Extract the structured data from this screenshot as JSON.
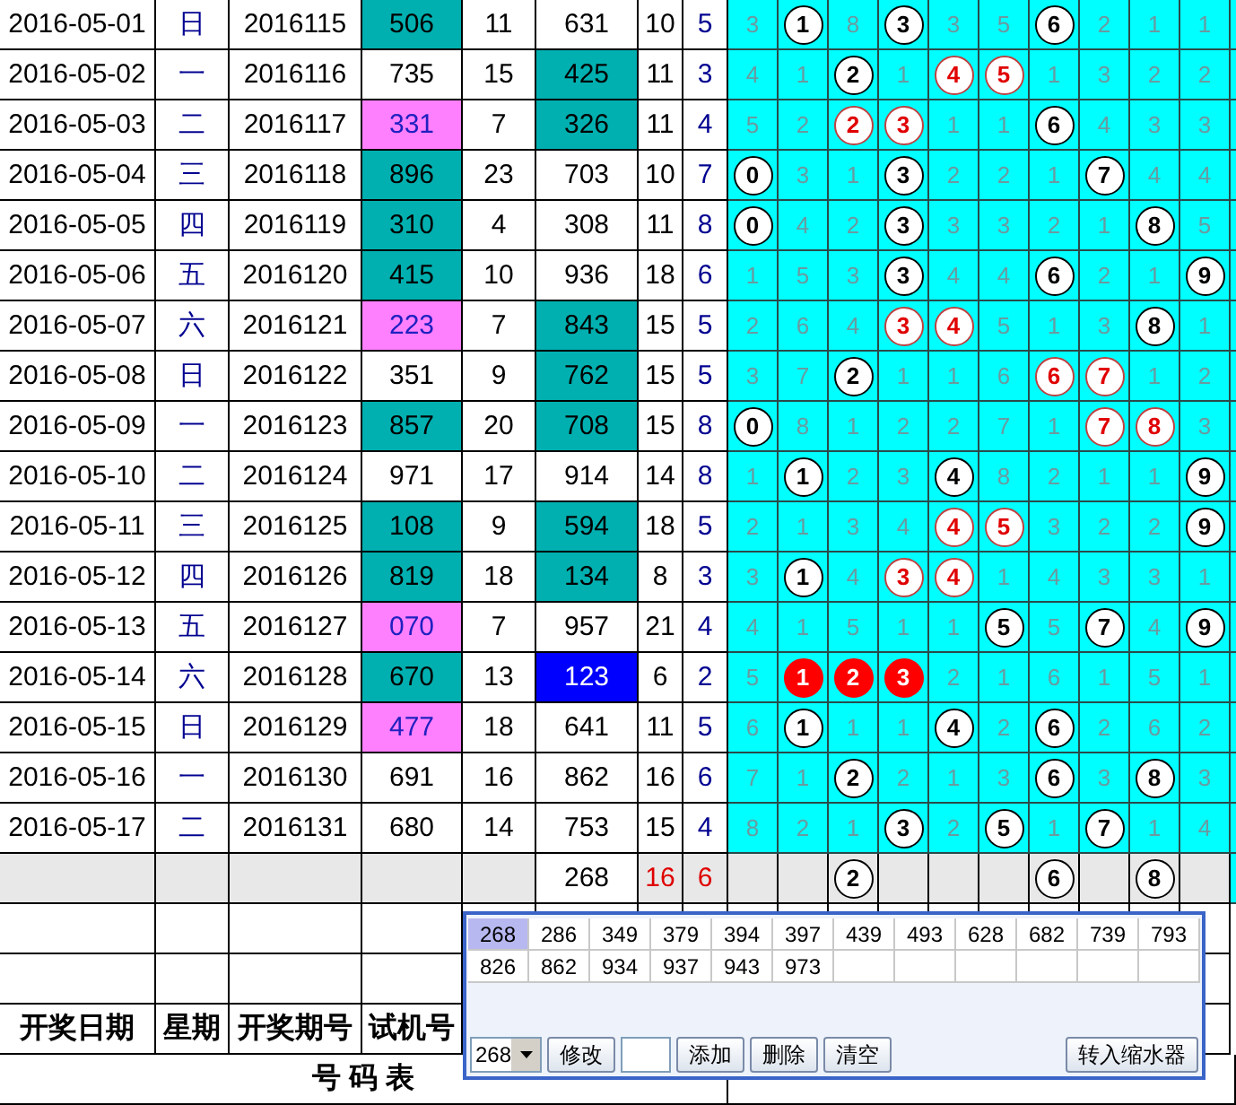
{
  "rows": [
    {
      "date": "2016-05-01",
      "weekday": "日",
      "period": "2016115",
      "trial": {
        "text": "506",
        "kind": "teal"
      },
      "col_5": "11",
      "col_6": {
        "text": "631",
        "kind": "plain"
      },
      "col_7": "10",
      "col_8": "5",
      "digits": [
        {
          "text": "3",
          "kind": "miss"
        },
        {
          "text": "1",
          "kind": "ball"
        },
        {
          "text": "8",
          "kind": "miss"
        },
        {
          "text": "3",
          "kind": "ball"
        },
        {
          "text": "3",
          "kind": "miss"
        },
        {
          "text": "5",
          "kind": "miss"
        },
        {
          "text": "6",
          "kind": "ball"
        },
        {
          "text": "2",
          "kind": "miss"
        },
        {
          "text": "1",
          "kind": "miss"
        },
        {
          "text": "1",
          "kind": "miss"
        }
      ]
    },
    {
      "date": "2016-05-02",
      "weekday": "一",
      "period": "2016116",
      "trial": {
        "text": "735",
        "kind": "plain"
      },
      "col_5": "15",
      "col_6": {
        "text": "425",
        "kind": "teal"
      },
      "col_7": "11",
      "col_8": "3",
      "digits": [
        {
          "text": "4",
          "kind": "miss"
        },
        {
          "text": "1",
          "kind": "miss"
        },
        {
          "text": "2",
          "kind": "ball"
        },
        {
          "text": "1",
          "kind": "miss"
        },
        {
          "text": "4",
          "kind": "pair"
        },
        {
          "text": "5",
          "kind": "pair"
        },
        {
          "text": "1",
          "kind": "miss"
        },
        {
          "text": "3",
          "kind": "miss"
        },
        {
          "text": "2",
          "kind": "miss"
        },
        {
          "text": "2",
          "kind": "miss"
        }
      ]
    },
    {
      "date": "2016-05-03",
      "weekday": "二",
      "period": "2016117",
      "trial": {
        "text": "331",
        "kind": "pink"
      },
      "col_5": "7",
      "col_6": {
        "text": "326",
        "kind": "teal"
      },
      "col_7": "11",
      "col_8": "4",
      "digits": [
        {
          "text": "5",
          "kind": "miss"
        },
        {
          "text": "2",
          "kind": "miss"
        },
        {
          "text": "2",
          "kind": "pair"
        },
        {
          "text": "3",
          "kind": "pair"
        },
        {
          "text": "1",
          "kind": "miss"
        },
        {
          "text": "1",
          "kind": "miss"
        },
        {
          "text": "6",
          "kind": "ball"
        },
        {
          "text": "4",
          "kind": "miss"
        },
        {
          "text": "3",
          "kind": "miss"
        },
        {
          "text": "3",
          "kind": "miss"
        }
      ]
    },
    {
      "date": "2016-05-04",
      "weekday": "三",
      "period": "2016118",
      "trial": {
        "text": "896",
        "kind": "teal"
      },
      "col_5": "23",
      "col_6": {
        "text": "703",
        "kind": "plain"
      },
      "col_7": "10",
      "col_8": "7",
      "digits": [
        {
          "text": "0",
          "kind": "ball"
        },
        {
          "text": "3",
          "kind": "miss"
        },
        {
          "text": "1",
          "kind": "miss"
        },
        {
          "text": "3",
          "kind": "ball"
        },
        {
          "text": "2",
          "kind": "miss"
        },
        {
          "text": "2",
          "kind": "miss"
        },
        {
          "text": "1",
          "kind": "miss"
        },
        {
          "text": "7",
          "kind": "ball"
        },
        {
          "text": "4",
          "kind": "miss"
        },
        {
          "text": "4",
          "kind": "miss"
        }
      ]
    },
    {
      "date": "2016-05-05",
      "weekday": "四",
      "period": "2016119",
      "trial": {
        "text": "310",
        "kind": "teal"
      },
      "col_5": "4",
      "col_6": {
        "text": "308",
        "kind": "plain"
      },
      "col_7": "11",
      "col_8": "8",
      "digits": [
        {
          "text": "0",
          "kind": "ball"
        },
        {
          "text": "4",
          "kind": "miss"
        },
        {
          "text": "2",
          "kind": "miss"
        },
        {
          "text": "3",
          "kind": "ball"
        },
        {
          "text": "3",
          "kind": "miss"
        },
        {
          "text": "3",
          "kind": "miss"
        },
        {
          "text": "2",
          "kind": "miss"
        },
        {
          "text": "1",
          "kind": "miss"
        },
        {
          "text": "8",
          "kind": "ball"
        },
        {
          "text": "5",
          "kind": "miss"
        }
      ]
    },
    {
      "date": "2016-05-06",
      "weekday": "五",
      "period": "2016120",
      "trial": {
        "text": "415",
        "kind": "teal"
      },
      "col_5": "10",
      "col_6": {
        "text": "936",
        "kind": "plain"
      },
      "col_7": "18",
      "col_8": "6",
      "digits": [
        {
          "text": "1",
          "kind": "miss"
        },
        {
          "text": "5",
          "kind": "miss"
        },
        {
          "text": "3",
          "kind": "miss"
        },
        {
          "text": "3",
          "kind": "ball"
        },
        {
          "text": "4",
          "kind": "miss"
        },
        {
          "text": "4",
          "kind": "miss"
        },
        {
          "text": "6",
          "kind": "ball"
        },
        {
          "text": "2",
          "kind": "miss"
        },
        {
          "text": "1",
          "kind": "miss"
        },
        {
          "text": "9",
          "kind": "ball"
        }
      ]
    },
    {
      "date": "2016-05-07",
      "weekday": "六",
      "period": "2016121",
      "trial": {
        "text": "223",
        "kind": "pink"
      },
      "col_5": "7",
      "col_6": {
        "text": "843",
        "kind": "teal"
      },
      "col_7": "15",
      "col_8": "5",
      "digits": [
        {
          "text": "2",
          "kind": "miss"
        },
        {
          "text": "6",
          "kind": "miss"
        },
        {
          "text": "4",
          "kind": "miss"
        },
        {
          "text": "3",
          "kind": "pair"
        },
        {
          "text": "4",
          "kind": "pair"
        },
        {
          "text": "5",
          "kind": "miss"
        },
        {
          "text": "1",
          "kind": "miss"
        },
        {
          "text": "3",
          "kind": "miss"
        },
        {
          "text": "8",
          "kind": "ball"
        },
        {
          "text": "1",
          "kind": "miss"
        }
      ]
    },
    {
      "date": "2016-05-08",
      "weekday": "日",
      "period": "2016122",
      "trial": {
        "text": "351",
        "kind": "plain"
      },
      "col_5": "9",
      "col_6": {
        "text": "762",
        "kind": "teal"
      },
      "col_7": "15",
      "col_8": "5",
      "digits": [
        {
          "text": "3",
          "kind": "miss"
        },
        {
          "text": "7",
          "kind": "miss"
        },
        {
          "text": "2",
          "kind": "ball"
        },
        {
          "text": "1",
          "kind": "miss"
        },
        {
          "text": "1",
          "kind": "miss"
        },
        {
          "text": "6",
          "kind": "miss"
        },
        {
          "text": "6",
          "kind": "pair"
        },
        {
          "text": "7",
          "kind": "pair"
        },
        {
          "text": "1",
          "kind": "miss"
        },
        {
          "text": "2",
          "kind": "miss"
        }
      ]
    },
    {
      "date": "2016-05-09",
      "weekday": "一",
      "period": "2016123",
      "trial": {
        "text": "857",
        "kind": "teal"
      },
      "col_5": "20",
      "col_6": {
        "text": "708",
        "kind": "teal"
      },
      "col_7": "15",
      "col_8": "8",
      "digits": [
        {
          "text": "0",
          "kind": "ball"
        },
        {
          "text": "8",
          "kind": "miss"
        },
        {
          "text": "1",
          "kind": "miss"
        },
        {
          "text": "2",
          "kind": "miss"
        },
        {
          "text": "2",
          "kind": "miss"
        },
        {
          "text": "7",
          "kind": "miss"
        },
        {
          "text": "1",
          "kind": "miss"
        },
        {
          "text": "7",
          "kind": "pair"
        },
        {
          "text": "8",
          "kind": "pair"
        },
        {
          "text": "3",
          "kind": "miss"
        }
      ]
    },
    {
      "date": "2016-05-10",
      "weekday": "二",
      "period": "2016124",
      "trial": {
        "text": "971",
        "kind": "plain"
      },
      "col_5": "17",
      "col_6": {
        "text": "914",
        "kind": "plain"
      },
      "col_7": "14",
      "col_8": "8",
      "digits": [
        {
          "text": "1",
          "kind": "miss"
        },
        {
          "text": "1",
          "kind": "ball"
        },
        {
          "text": "2",
          "kind": "miss"
        },
        {
          "text": "3",
          "kind": "miss"
        },
        {
          "text": "4",
          "kind": "ball"
        },
        {
          "text": "8",
          "kind": "miss"
        },
        {
          "text": "2",
          "kind": "miss"
        },
        {
          "text": "1",
          "kind": "miss"
        },
        {
          "text": "1",
          "kind": "miss"
        },
        {
          "text": "9",
          "kind": "ball"
        }
      ]
    },
    {
      "date": "2016-05-11",
      "weekday": "三",
      "period": "2016125",
      "trial": {
        "text": "108",
        "kind": "teal"
      },
      "col_5": "9",
      "col_6": {
        "text": "594",
        "kind": "teal"
      },
      "col_7": "18",
      "col_8": "5",
      "digits": [
        {
          "text": "2",
          "kind": "miss"
        },
        {
          "text": "1",
          "kind": "miss"
        },
        {
          "text": "3",
          "kind": "miss"
        },
        {
          "text": "4",
          "kind": "miss"
        },
        {
          "text": "4",
          "kind": "pair"
        },
        {
          "text": "5",
          "kind": "pair"
        },
        {
          "text": "3",
          "kind": "miss"
        },
        {
          "text": "2",
          "kind": "miss"
        },
        {
          "text": "2",
          "kind": "miss"
        },
        {
          "text": "9",
          "kind": "ball"
        }
      ]
    },
    {
      "date": "2016-05-12",
      "weekday": "四",
      "period": "2016126",
      "trial": {
        "text": "819",
        "kind": "teal"
      },
      "col_5": "18",
      "col_6": {
        "text": "134",
        "kind": "teal"
      },
      "col_7": "8",
      "col_8": "3",
      "digits": [
        {
          "text": "3",
          "kind": "miss"
        },
        {
          "text": "1",
          "kind": "ball"
        },
        {
          "text": "4",
          "kind": "miss"
        },
        {
          "text": "3",
          "kind": "pair"
        },
        {
          "text": "4",
          "kind": "pair"
        },
        {
          "text": "1",
          "kind": "miss"
        },
        {
          "text": "4",
          "kind": "miss"
        },
        {
          "text": "3",
          "kind": "miss"
        },
        {
          "text": "3",
          "kind": "miss"
        },
        {
          "text": "1",
          "kind": "miss"
        }
      ]
    },
    {
      "date": "2016-05-13",
      "weekday": "五",
      "period": "2016127",
      "trial": {
        "text": "070",
        "kind": "pink"
      },
      "col_5": "7",
      "col_6": {
        "text": "957",
        "kind": "plain"
      },
      "col_7": "21",
      "col_8": "4",
      "digits": [
        {
          "text": "4",
          "kind": "miss"
        },
        {
          "text": "1",
          "kind": "miss"
        },
        {
          "text": "5",
          "kind": "miss"
        },
        {
          "text": "1",
          "kind": "miss"
        },
        {
          "text": "1",
          "kind": "miss"
        },
        {
          "text": "5",
          "kind": "ball"
        },
        {
          "text": "5",
          "kind": "miss"
        },
        {
          "text": "7",
          "kind": "ball"
        },
        {
          "text": "4",
          "kind": "miss"
        },
        {
          "text": "9",
          "kind": "ball"
        }
      ]
    },
    {
      "date": "2016-05-14",
      "weekday": "六",
      "period": "2016128",
      "trial": {
        "text": "670",
        "kind": "teal"
      },
      "col_5": "13",
      "col_6": {
        "text": "123",
        "kind": "blue"
      },
      "col_7": "6",
      "col_8": "2",
      "digits": [
        {
          "text": "5",
          "kind": "miss"
        },
        {
          "text": "1",
          "kind": "run"
        },
        {
          "text": "2",
          "kind": "run"
        },
        {
          "text": "3",
          "kind": "run"
        },
        {
          "text": "2",
          "kind": "miss"
        },
        {
          "text": "1",
          "kind": "miss"
        },
        {
          "text": "6",
          "kind": "miss"
        },
        {
          "text": "1",
          "kind": "miss"
        },
        {
          "text": "5",
          "kind": "miss"
        },
        {
          "text": "1",
          "kind": "miss"
        }
      ]
    },
    {
      "date": "2016-05-15",
      "weekday": "日",
      "period": "2016129",
      "trial": {
        "text": "477",
        "kind": "pink"
      },
      "col_5": "18",
      "col_6": {
        "text": "641",
        "kind": "plain"
      },
      "col_7": "11",
      "col_8": "5",
      "digits": [
        {
          "text": "6",
          "kind": "miss"
        },
        {
          "text": "1",
          "kind": "ball"
        },
        {
          "text": "1",
          "kind": "miss"
        },
        {
          "text": "1",
          "kind": "miss"
        },
        {
          "text": "4",
          "kind": "ball"
        },
        {
          "text": "2",
          "kind": "miss"
        },
        {
          "text": "6",
          "kind": "ball"
        },
        {
          "text": "2",
          "kind": "miss"
        },
        {
          "text": "6",
          "kind": "miss"
        },
        {
          "text": "2",
          "kind": "miss"
        }
      ]
    },
    {
      "date": "2016-05-16",
      "weekday": "一",
      "period": "2016130",
      "trial": {
        "text": "691",
        "kind": "plain"
      },
      "col_5": "16",
      "col_6": {
        "text": "862",
        "kind": "plain"
      },
      "col_7": "16",
      "col_8": "6",
      "digits": [
        {
          "text": "7",
          "kind": "miss"
        },
        {
          "text": "1",
          "kind": "miss"
        },
        {
          "text": "2",
          "kind": "ball"
        },
        {
          "text": "2",
          "kind": "miss"
        },
        {
          "text": "1",
          "kind": "miss"
        },
        {
          "text": "3",
          "kind": "miss"
        },
        {
          "text": "6",
          "kind": "ball"
        },
        {
          "text": "3",
          "kind": "miss"
        },
        {
          "text": "8",
          "kind": "ball"
        },
        {
          "text": "3",
          "kind": "miss"
        }
      ]
    },
    {
      "date": "2016-05-17",
      "weekday": "二",
      "period": "2016131",
      "trial": {
        "text": "680",
        "kind": "plain"
      },
      "col_5": "14",
      "col_6": {
        "text": "753",
        "kind": "plain"
      },
      "col_7": "15",
      "col_8": "4",
      "digits": [
        {
          "text": "8",
          "kind": "miss"
        },
        {
          "text": "2",
          "kind": "miss"
        },
        {
          "text": "1",
          "kind": "miss"
        },
        {
          "text": "3",
          "kind": "ball"
        },
        {
          "text": "2",
          "kind": "miss"
        },
        {
          "text": "5",
          "kind": "ball"
        },
        {
          "text": "1",
          "kind": "miss"
        },
        {
          "text": "7",
          "kind": "ball"
        },
        {
          "text": "1",
          "kind": "miss"
        },
        {
          "text": "4",
          "kind": "miss"
        }
      ]
    }
  ],
  "summary": {
    "col_6": "268",
    "col_7": "16",
    "col_8": "6",
    "digits": [
      {
        "kind": "blank"
      },
      {
        "kind": "blank"
      },
      {
        "text": "2",
        "kind": "ball"
      },
      {
        "kind": "blank"
      },
      {
        "kind": "blank"
      },
      {
        "kind": "blank"
      },
      {
        "text": "6",
        "kind": "ball"
      },
      {
        "kind": "blank"
      },
      {
        "text": "8",
        "kind": "ball"
      },
      {
        "kind": "blank"
      }
    ]
  },
  "header": [
    "开奖日期",
    "星期",
    "开奖期号",
    "试机号"
  ],
  "footer_title": "号 码 表",
  "popup": {
    "values": [
      {
        "text": "268",
        "selected": true
      },
      {
        "text": "286",
        "selected": false
      },
      {
        "text": "349",
        "selected": false
      },
      {
        "text": "379",
        "selected": false
      },
      {
        "text": "394",
        "selected": false
      },
      {
        "text": "397",
        "selected": false
      },
      {
        "text": "439",
        "selected": false
      },
      {
        "text": "493",
        "selected": false
      },
      {
        "text": "628",
        "selected": false
      },
      {
        "text": "682",
        "selected": false
      },
      {
        "text": "739",
        "selected": false
      },
      {
        "text": "793",
        "selected": false
      },
      {
        "text": "826",
        "selected": false
      },
      {
        "text": "862",
        "selected": false
      },
      {
        "text": "934",
        "selected": false
      },
      {
        "text": "937",
        "selected": false
      },
      {
        "text": "943",
        "selected": false
      },
      {
        "text": "973",
        "selected": false
      }
    ],
    "combo": "268",
    "toolbar": [
      {
        "kind": "button",
        "label": "修改"
      },
      {
        "kind": "input"
      },
      {
        "kind": "button",
        "label": "添加"
      },
      {
        "kind": "button",
        "label": "删除"
      },
      {
        "kind": "button",
        "label": "清空"
      }
    ],
    "transfer_button": "转入缩水器"
  }
}
